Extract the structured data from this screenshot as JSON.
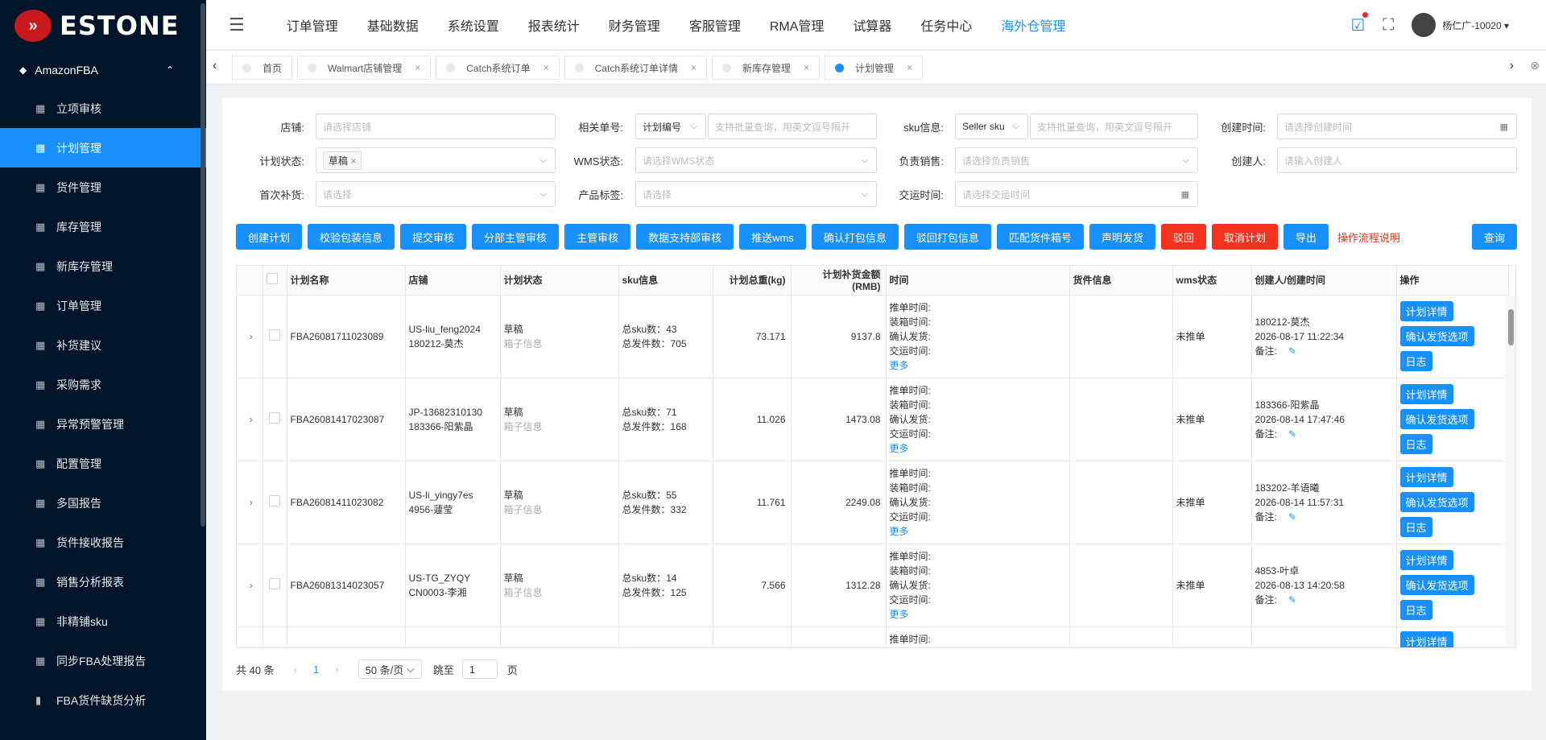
{
  "brand": {
    "name": "ESTONE",
    "mark": "»"
  },
  "sidebar": {
    "group": "AmazonFBA",
    "items": [
      {
        "label": "立项审核",
        "icon": "grid-icon"
      },
      {
        "label": "计划管理",
        "icon": "grid-icon"
      },
      {
        "label": "货件管理",
        "icon": "grid-icon"
      },
      {
        "label": "库存管理",
        "icon": "grid-icon"
      },
      {
        "label": "新库存管理",
        "icon": "grid-icon"
      },
      {
        "label": "订单管理",
        "icon": "grid-icon"
      },
      {
        "label": "补货建议",
        "icon": "grid-icon"
      },
      {
        "label": "采购需求",
        "icon": "grid-icon"
      },
      {
        "label": "异常预警管理",
        "icon": "grid-icon"
      },
      {
        "label": "配置管理",
        "icon": "grid-icon"
      },
      {
        "label": "多国报告",
        "icon": "grid-icon"
      },
      {
        "label": "货件接收报告",
        "icon": "grid-icon"
      },
      {
        "label": "销售分析报表",
        "icon": "grid-icon"
      },
      {
        "label": "非精铺sku",
        "icon": "grid-icon"
      },
      {
        "label": "同步FBA处理报告",
        "icon": "grid-icon"
      },
      {
        "label": "FBA货件缺货分析",
        "icon": "bar-chart-icon"
      }
    ],
    "active_index": 1
  },
  "header": {
    "nav": [
      "订单管理",
      "基础数据",
      "系统设置",
      "报表统计",
      "财务管理",
      "客服管理",
      "RMA管理",
      "试算器",
      "任务中心",
      "海外仓管理"
    ],
    "active_nav": "海外仓管理",
    "user": "杨仁广-10020"
  },
  "tabs": [
    {
      "label": "首页",
      "closable": false
    },
    {
      "label": "Walmart店铺管理",
      "closable": true
    },
    {
      "label": "Catch系统订单",
      "closable": true
    },
    {
      "label": "Catch系统订单详情",
      "closable": true
    },
    {
      "label": "新库存管理",
      "closable": true
    },
    {
      "label": "计划管理",
      "closable": true,
      "active": true
    }
  ],
  "filters": {
    "shop": {
      "label": "店铺:",
      "placeholder": "请选择店铺"
    },
    "related_no": {
      "label": "相关单号:",
      "type": "计划编号",
      "placeholder": "支持批量查询，用英文逗号隔开"
    },
    "sku_info": {
      "label": "sku信息:",
      "type": "Seller sku",
      "placeholder": "支持批量查询，用英文逗号隔开"
    },
    "create_time": {
      "label": "创建时间:",
      "placeholder": "请选择创建时间"
    },
    "plan_status": {
      "label": "计划状态:",
      "tag": "草稿"
    },
    "wms_status": {
      "label": "WMS状态:",
      "placeholder": "请选择WMS状态"
    },
    "sales_owner": {
      "label": "负责销售:",
      "placeholder": "请选择负责销售"
    },
    "creator": {
      "label": "创建人:",
      "placeholder": "请输入创建人"
    },
    "first_replenish": {
      "label": "首次补货:",
      "placeholder": "请选择"
    },
    "product_tag": {
      "label": "产品标签:",
      "placeholder": "请选择"
    },
    "ship_time": {
      "label": "交运时间:",
      "placeholder": "请选择交运时间"
    }
  },
  "actions": {
    "blue": [
      "创建计划",
      "校验包装信息",
      "提交审核",
      "分部主管审核",
      "主管审核",
      "数据支持部审核",
      "推送wms",
      "确认打包信息",
      "驳回打包信息",
      "匹配货件箱号",
      "声明发货"
    ],
    "red": [
      "驳回",
      "取消计划"
    ],
    "export": "导出",
    "help": "操作流程说明",
    "query": "查询"
  },
  "table": {
    "headers": [
      "计划名称",
      "店铺",
      "计划状态",
      "sku信息",
      "计划总重(kg)",
      "计划补货金额(RMB)",
      "时间",
      "货件信息",
      "wms状态",
      "创建人/创建时间",
      "操作"
    ],
    "time_labels": [
      "推单时间:",
      "装箱时间:",
      "确认发货:",
      "交运时间:"
    ],
    "more": "更多",
    "box_info": "箱子信息",
    "sku_total_label": "总sku数：",
    "qty_total_label": "总发件数：",
    "remark_label": "备注:",
    "row_actions": [
      "计划详情",
      "确认发货选项",
      "日志"
    ],
    "rows": [
      {
        "name": "FBA26081711023089",
        "shop": "US-liu_feng2024",
        "shop_user": "180212-莫杰",
        "status": "草稿",
        "sku_total": "43",
        "qty_total": "705",
        "weight": "73.171",
        "amount": "9137.8",
        "wms": "未推单",
        "creator": "180212-莫杰",
        "created": "2026-08-17 11:22:34"
      },
      {
        "name": "FBA26081417023087",
        "shop": "JP-13682310130",
        "shop_user": "183366-阳紫晶",
        "status": "草稿",
        "sku_total": "71",
        "qty_total": "168",
        "weight": "11.026",
        "amount": "1473.08",
        "wms": "未推单",
        "creator": "183366-阳紫晶",
        "created": "2026-08-14 17:47:46"
      },
      {
        "name": "FBA26081411023082",
        "shop": "US-li_yingy7es",
        "shop_user": "4956-蘧莹",
        "status": "草稿",
        "sku_total": "55",
        "qty_total": "332",
        "weight": "11.761",
        "amount": "2249.08",
        "wms": "未推单",
        "creator": "183202-羊语曦",
        "created": "2026-08-14 11:57:31"
      },
      {
        "name": "FBA26081314023057",
        "shop": "US-TG_ZYQY",
        "shop_user": "CN0003-李湘",
        "status": "草稿",
        "sku_total": "14",
        "qty_total": "125",
        "weight": "7.566",
        "amount": "1312.28",
        "wms": "未推单",
        "creator": "4853-叶卓",
        "created": "2026-08-13 14:20:58"
      }
    ]
  },
  "pager": {
    "total": "共 40 条",
    "page": "1",
    "size": "50 条/页",
    "jump_label": "跳至",
    "jump_value": "1",
    "page_suffix": "页"
  },
  "colors": {
    "primary": "#1890ff",
    "danger": "#f5321d",
    "sidebar_bg": "#001529"
  }
}
